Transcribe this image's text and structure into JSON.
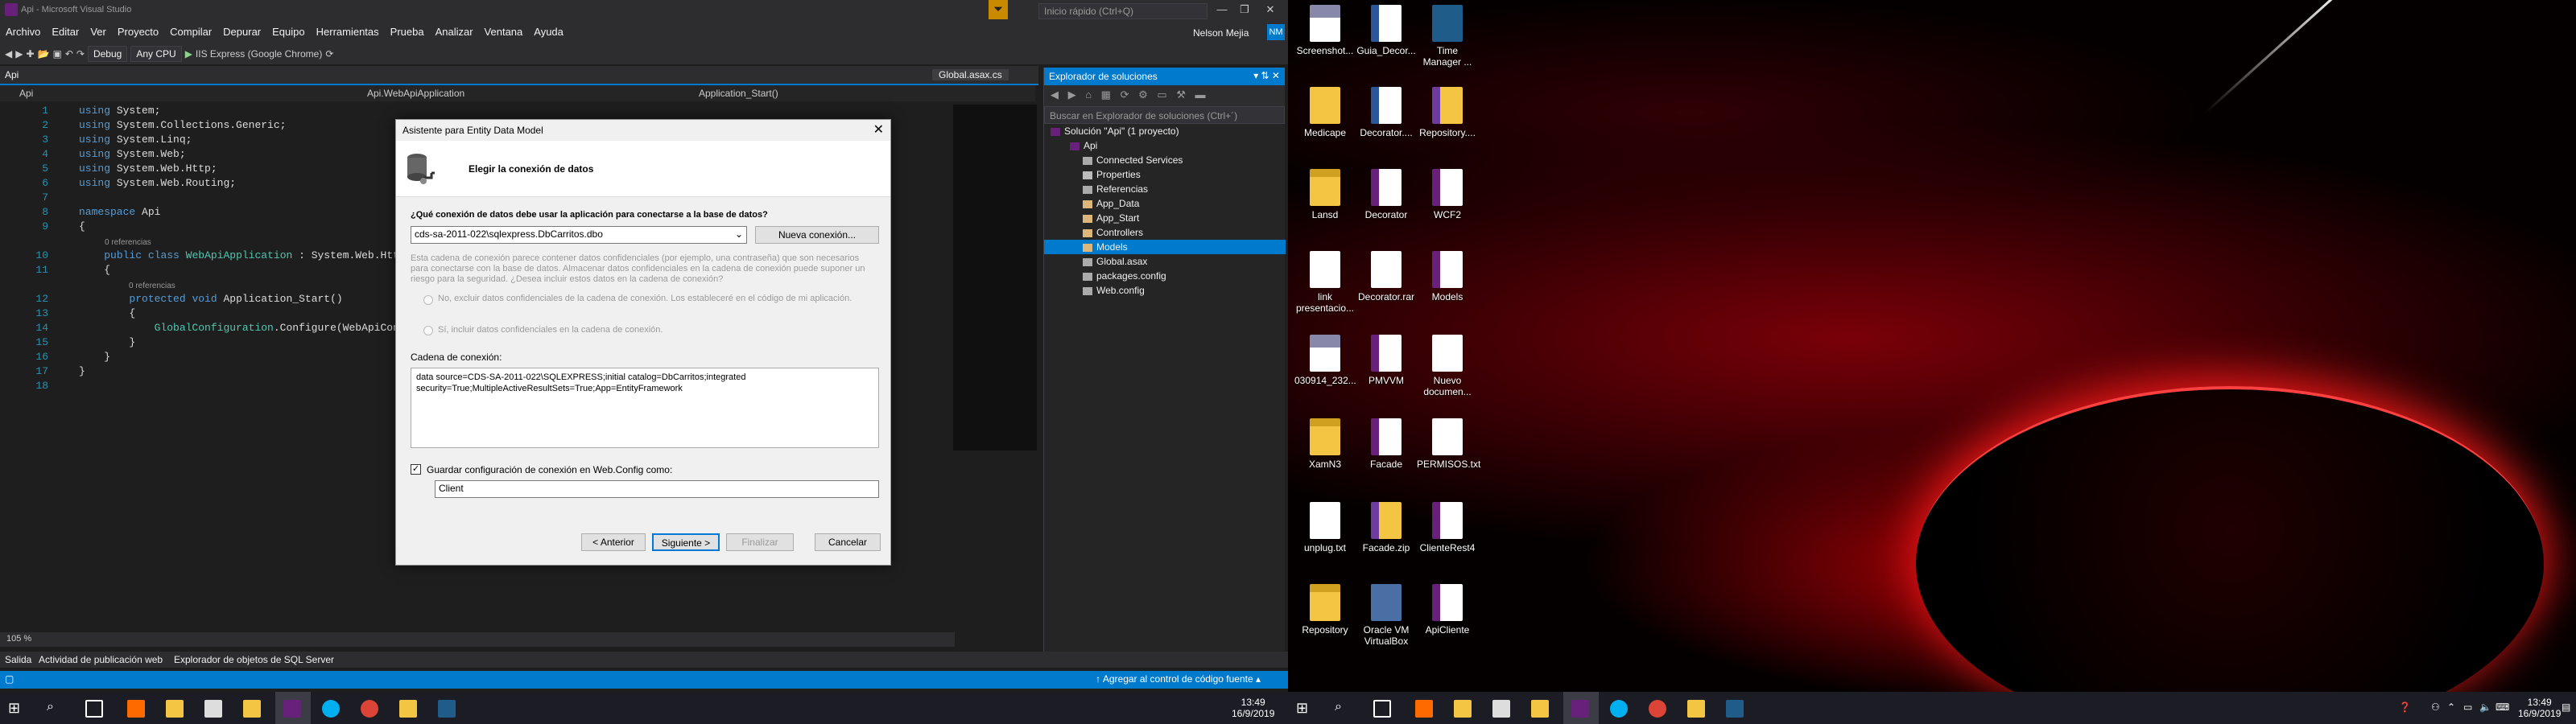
{
  "vs": {
    "title": "Api - Microsoft Visual Studio",
    "menu": [
      "Archivo",
      "Editar",
      "Ver",
      "Proyecto",
      "Compilar",
      "Depurar",
      "Equipo",
      "Herramientas",
      "Prueba",
      "Analizar",
      "Ventana",
      "Ayuda"
    ],
    "quick_launch": "Inicio rápido (Ctrl+Q)",
    "user": "Nelson Mejia",
    "user_initials": "NM",
    "toolbar": {
      "config": "Debug",
      "platform": "Any CPU",
      "run": "IIS Express (Google Chrome)"
    },
    "project_label": "Api",
    "tab_global": "Global.asax.cs",
    "nav": {
      "project": "Api",
      "class": "Api.WebApiApplication",
      "member": "Application_Start()"
    },
    "code": [
      {
        "n": "1",
        "text": "using System;"
      },
      {
        "n": "2",
        "text": "using System.Collections.Generic;"
      },
      {
        "n": "3",
        "text": "using System.Linq;"
      },
      {
        "n": "4",
        "text": "using System.Web;"
      },
      {
        "n": "5",
        "text": "using System.Web.Http;"
      },
      {
        "n": "6",
        "text": "using System.Web.Routing;"
      },
      {
        "n": "7",
        "text": ""
      },
      {
        "n": "8",
        "text": "namespace Api"
      },
      {
        "n": "9",
        "text": "{"
      },
      {
        "n": "10",
        "text": "    public class WebApiApplication : System.Web.Http"
      },
      {
        "n": "11",
        "text": "    {"
      },
      {
        "n": "12",
        "text": "        protected void Application_Start()"
      },
      {
        "n": "13",
        "text": "        {"
      },
      {
        "n": "14",
        "text": "            GlobalConfiguration.Configure(WebApiConf"
      },
      {
        "n": "15",
        "text": "        }"
      },
      {
        "n": "16",
        "text": "    }"
      },
      {
        "n": "17",
        "text": "}"
      },
      {
        "n": "18",
        "text": ""
      }
    ],
    "refs": "0 referencias",
    "zoom": "105 %",
    "output_tabs": [
      "Salida",
      "Actividad de publicación web",
      "Explorador de objetos de SQL Server"
    ],
    "status_right": "Agregar al control de código fuente"
  },
  "explorer": {
    "title": "Explorador de soluciones",
    "search": "Buscar en Explorador de soluciones (Ctrl+´)",
    "items": [
      {
        "label": "Solución \"Api\" (1 proyecto)",
        "level": 0,
        "icon": "solution"
      },
      {
        "label": "Api",
        "level": 1,
        "icon": "cs-project"
      },
      {
        "label": "Connected Services",
        "level": 2,
        "icon": "cloud"
      },
      {
        "label": "Properties",
        "level": 2,
        "icon": "wrench"
      },
      {
        "label": "Referencias",
        "level": 2,
        "icon": "references"
      },
      {
        "label": "App_Data",
        "level": 2,
        "icon": "folder"
      },
      {
        "label": "App_Start",
        "level": 2,
        "icon": "folder"
      },
      {
        "label": "Controllers",
        "level": 2,
        "icon": "folder"
      },
      {
        "label": "Models",
        "level": 2,
        "icon": "folder",
        "selected": true
      },
      {
        "label": "Global.asax",
        "level": 2,
        "icon": "asax"
      },
      {
        "label": "packages.config",
        "level": 2,
        "icon": "config"
      },
      {
        "label": "Web.config",
        "level": 2,
        "icon": "config"
      }
    ]
  },
  "dialog": {
    "title": "Asistente para Entity Data Model",
    "heading": "Elegir la conexión de datos",
    "question": "¿Qué conexión de datos debe usar la aplicación para conectarse a la base de datos?",
    "connection": "cds-sa-2011-022\\sqlexpress.DbCarritos.dbo",
    "new_connection": "Nueva conexión...",
    "warning": "Esta cadena de conexión parece contener datos confidenciales (por ejemplo, una contraseña) que son necesarios para conectarse con la base de datos. Almacenar datos confidenciales en la cadena de conexión puede suponer un riesgo para la seguridad. ¿Desea incluir estos datos en la cadena de conexión?",
    "radio_no": "No, excluir datos confidenciales de la cadena de conexión. Los estableceré en el código de mi aplicación.",
    "radio_yes": "Sí, incluir datos confidenciales en la cadena de conexión.",
    "conn_label": "Cadena de conexión:",
    "conn_string": "data source=CDS-SA-2011-022\\SQLEXPRESS;initial catalog=DbCarritos;integrated security=True;MultipleActiveResultSets=True;App=EntityFramework",
    "save_label": "Guardar configuración de conexión en Web.Config como:",
    "save_value": "Client",
    "buttons": {
      "back": "< Anterior",
      "next": "Siguiente >",
      "finish": "Finalizar",
      "cancel": "Cancelar"
    }
  },
  "clock": {
    "time": "13:49",
    "date": "16/9/2019"
  },
  "desktop": [
    {
      "label": "Screenshot...",
      "icon": "image-doc"
    },
    {
      "label": "Guia_Decor...",
      "icon": "word"
    },
    {
      "label": "Time Manager ...",
      "icon": "app"
    },
    {
      "label": "Medicape",
      "icon": "folder"
    },
    {
      "label": "Decorator....",
      "icon": "word"
    },
    {
      "label": "Repository....",
      "icon": "zip"
    },
    {
      "label": "Lansd",
      "icon": "folder-zip"
    },
    {
      "label": "Decorator",
      "icon": "folder-cs"
    },
    {
      "label": "WCF2",
      "icon": "folder-cs"
    },
    {
      "label": "link presentacio...",
      "icon": "doc"
    },
    {
      "label": "Decorator.rar",
      "icon": "doc"
    },
    {
      "label": "Models",
      "icon": "folder-cs"
    },
    {
      "label": "030914_232...",
      "icon": "image-doc"
    },
    {
      "label": "PMVVM",
      "icon": "folder-cs"
    },
    {
      "label": "Nuevo documen...",
      "icon": "doc"
    },
    {
      "label": "XamN3",
      "icon": "folder-zip"
    },
    {
      "label": "Facade",
      "icon": "folder-cs"
    },
    {
      "label": "PERMISOS.txt",
      "icon": "doc"
    },
    {
      "label": "unplug.txt",
      "icon": "doc"
    },
    {
      "label": "Facade.zip",
      "icon": "zip"
    },
    {
      "label": "ClienteRest4",
      "icon": "folder-cs"
    },
    {
      "label": "Repository",
      "icon": "folder-zip"
    },
    {
      "label": "Oracle VM VirtualBox",
      "icon": "virtualbox"
    },
    {
      "label": "ApiCliente",
      "icon": "folder-cs"
    }
  ]
}
